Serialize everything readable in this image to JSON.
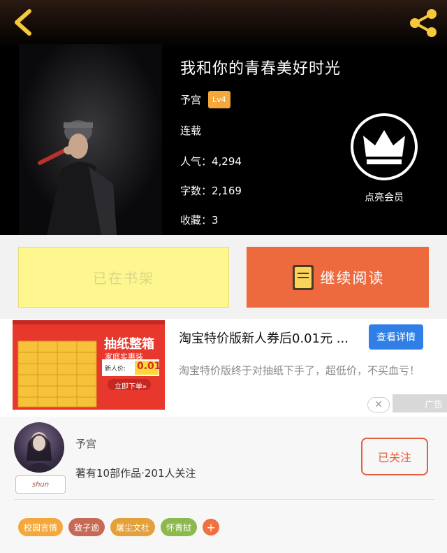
{
  "header": {
    "book_title": "我和你的青春美好时光",
    "author": "予宫",
    "level": "Lv4",
    "status": "连载",
    "popularity": "人气：4,294",
    "word_count": "字数：2,169",
    "favorites": "收藏：3",
    "vip_label": "点亮会员",
    "back_icon": "chevron-left-icon",
    "share_icon": "share-icon",
    "vip_icon": "crown-icon"
  },
  "actions": {
    "shelf_label": "已在书架",
    "read_label": "继续阅读",
    "read_icon": "book-icon"
  },
  "ad": {
    "image_title": "抽纸整箱",
    "image_subtitle": "家庭实惠装",
    "price_prefix": "新人价:",
    "price": "0.01",
    "order_label": "立即下单»",
    "title": "淘宝特价版新人券后0.01元 ...",
    "button": "查看详情",
    "description": "淘宝特价版终于对抽纸下手了，超低价，不买血亏！",
    "close": "✕",
    "tag": "广告"
  },
  "author_panel": {
    "name": "予宫",
    "name_tag": "shun",
    "info": "著有10部作品·201人关注",
    "follow_label": "已关注",
    "tags": [
      {
        "label": "校园言情",
        "color": "#f4a73a"
      },
      {
        "label": "致子逾",
        "color": "#c76a55"
      },
      {
        "label": "屠尘文社",
        "color": "#e3a03b"
      },
      {
        "label": "怀青挝",
        "color": "#8cb84e"
      }
    ],
    "add_tag": "+"
  },
  "colors": {
    "accent": "#ec6a3e",
    "shelf": "#fef68f",
    "badge": "#f4a73a",
    "ad_button": "#2f7fe6"
  }
}
